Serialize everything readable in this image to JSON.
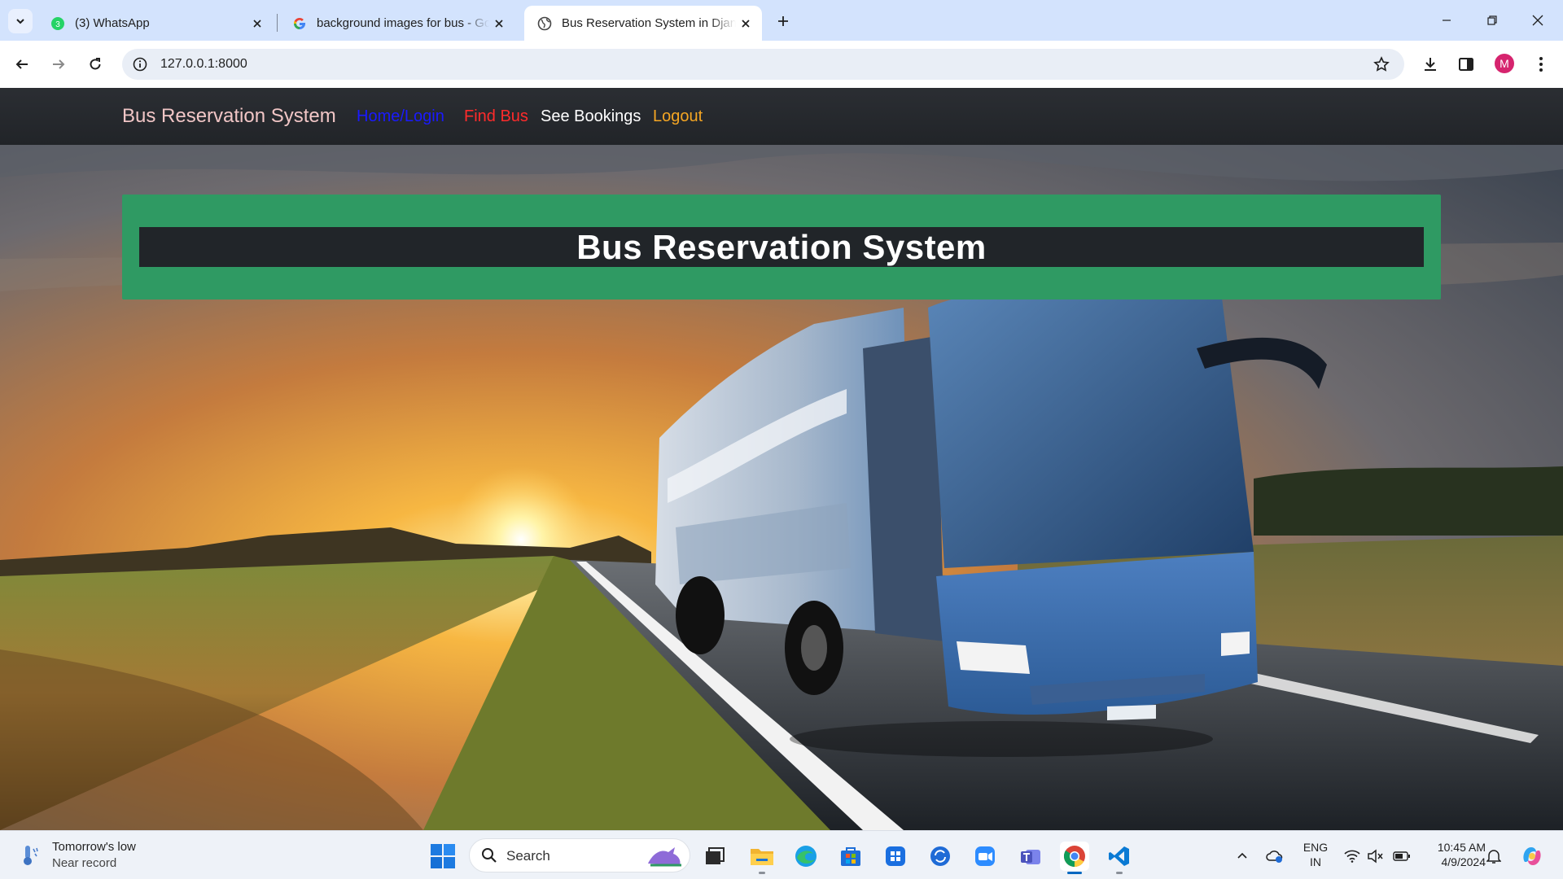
{
  "browser": {
    "tabs": [
      {
        "title": "(3) WhatsApp",
        "badge": "3",
        "active": false
      },
      {
        "title": "background images for bus - Go",
        "active": false
      },
      {
        "title": "Bus Reservation System in Djan",
        "active": true
      }
    ],
    "url": "127.0.0.1:8000",
    "profile_initial": "M"
  },
  "site": {
    "brand": "Bus Reservation System",
    "nav": {
      "home": "Home/Login",
      "find_bus": "Find Bus",
      "bookings": "See Bookings",
      "logout": "Logout"
    },
    "hero_title": "Bus Reservation System",
    "colors": {
      "hero_green": "#2f9a63",
      "navbar": "#212529"
    }
  },
  "taskbar": {
    "weather_title": "Tomorrow's low",
    "weather_sub": "Near record",
    "search_label": "Search",
    "lang_line1": "ENG",
    "lang_line2": "IN",
    "time": "10:45 AM",
    "date": "4/9/2024"
  }
}
